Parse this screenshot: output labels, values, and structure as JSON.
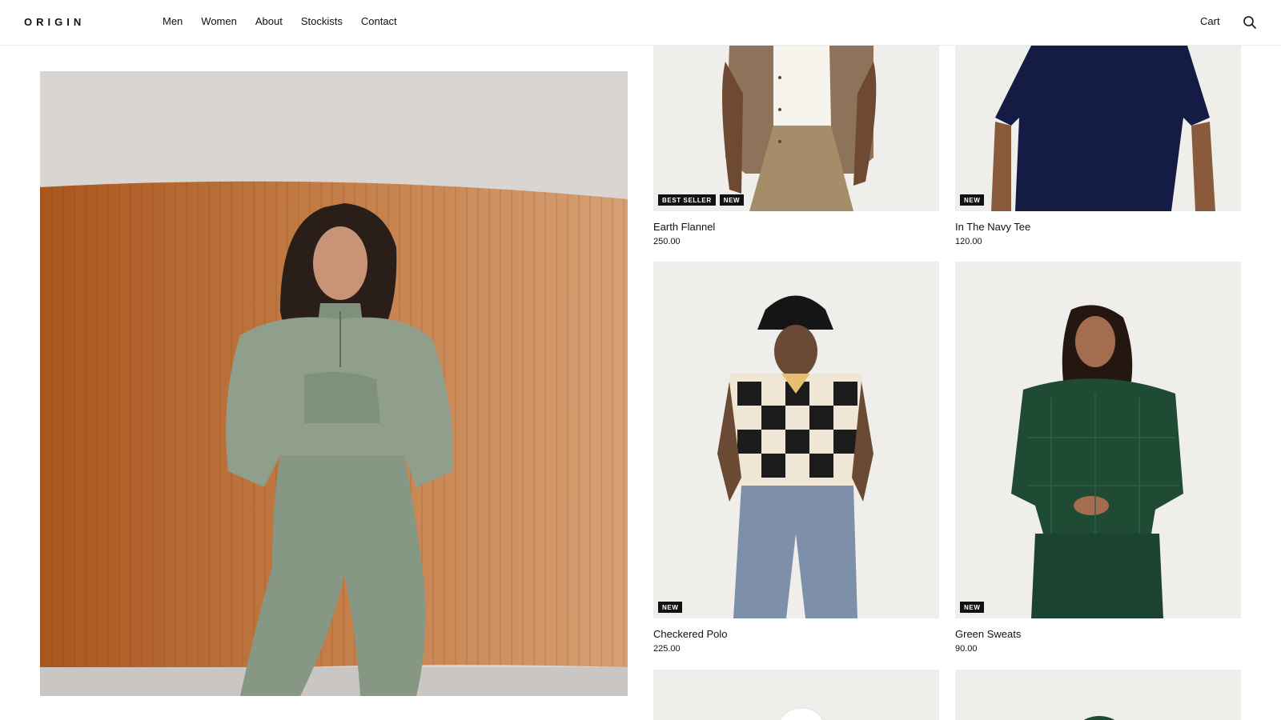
{
  "header": {
    "logo": "ORIGIN",
    "nav": [
      "Men",
      "Women",
      "About",
      "Stockists",
      "Contact"
    ],
    "cart_label": "Cart",
    "search_icon": "search-icon"
  },
  "products": [
    {
      "name": "Earth Flannel",
      "price": "250.00",
      "badges": [
        "BEST SELLER",
        "NEW"
      ]
    },
    {
      "name": "In The Navy Tee",
      "price": "120.00",
      "badges": [
        "NEW"
      ]
    },
    {
      "name": "Checkered Polo",
      "price": "225.00",
      "badges": [
        "NEW"
      ]
    },
    {
      "name": "Green Sweats",
      "price": "90.00",
      "badges": [
        "NEW"
      ]
    }
  ],
  "colors": {
    "accent": "#111111",
    "card_bg": "#f1efec",
    "hero_wall": "#b86a35",
    "hero_outfit": "#8f9f8c"
  }
}
